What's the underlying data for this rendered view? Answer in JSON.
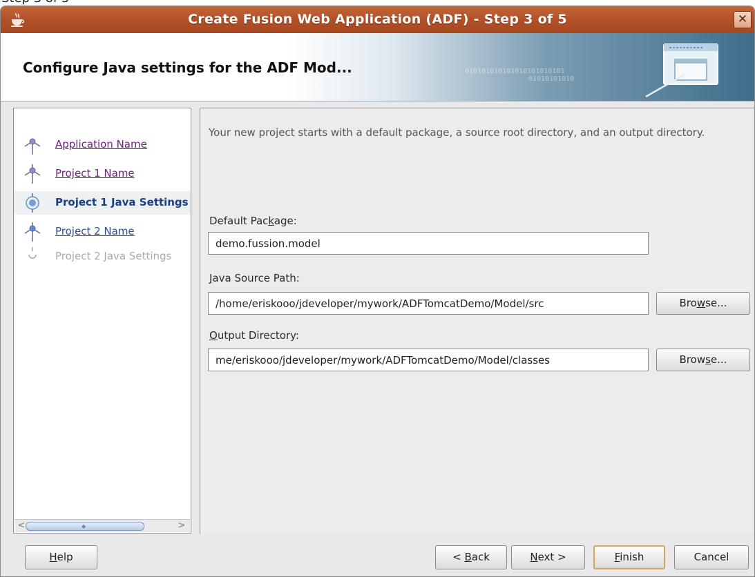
{
  "top_fragment": "Step 3 of 5",
  "window": {
    "title": "Create Fusion Web Application (ADF) - Step 3 of 5",
    "close_glyph": "✕",
    "app_icon": "java-coffee-cup-icon"
  },
  "header": {
    "title": "Configure Java settings for the ADF Mod...",
    "decor_binary": [
      "010101010101010101010101",
      "01010101010"
    ],
    "graphic_icon": "windows-pen-icon",
    "colors": {
      "gradient_dark": "#3f6d8b",
      "gradient_light": "#dfe8ef"
    }
  },
  "steps": [
    {
      "label": "Application Name",
      "state": "visited"
    },
    {
      "label": "Project 1 Name",
      "state": "visited"
    },
    {
      "label": "Project 1 Java Settings",
      "state": "current"
    },
    {
      "label": "Project 2 Name",
      "state": "link"
    },
    {
      "label": "Project 2 Java Settings",
      "state": "disabled"
    }
  ],
  "content": {
    "description": "Your new project starts with a default package, a source root directory, and an output directory.",
    "default_package": {
      "label_before": "Default Pac",
      "mnemonic": "k",
      "label_after": "age:",
      "value": "demo.fussion.model"
    },
    "java_source_path": {
      "mnemonic": "J",
      "label_after": "ava Source Path:",
      "value": "/home/eriskooo/jdeveloper/mywork/ADFTomcatDemo/Model/src"
    },
    "output_directory": {
      "mnemonic": "O",
      "label_after": "utput Directory:",
      "value": "me/eriskooo/jdeveloper/mywork/ADFTomcatDemo/Model/classes"
    },
    "browse_source": {
      "before": "Bro",
      "mnemonic": "w",
      "after": "se..."
    },
    "browse_output": {
      "before": "Brow",
      "mnemonic": "s",
      "after": "e..."
    }
  },
  "buttons": {
    "help": {
      "mnemonic": "H",
      "after": "elp"
    },
    "back": {
      "before": "< ",
      "mnemonic": "B",
      "after": "ack"
    },
    "next": {
      "mnemonic": "N",
      "after": "ext >"
    },
    "finish": {
      "mnemonic": "F",
      "after": "inish"
    },
    "cancel": "Cancel"
  },
  "colors": {
    "titlebar": "#b4522a",
    "visited_link": "#6f1f7e",
    "link": "#2a4d9c",
    "current_step": "#1b3f82",
    "finish_border": "#d8a35e"
  }
}
